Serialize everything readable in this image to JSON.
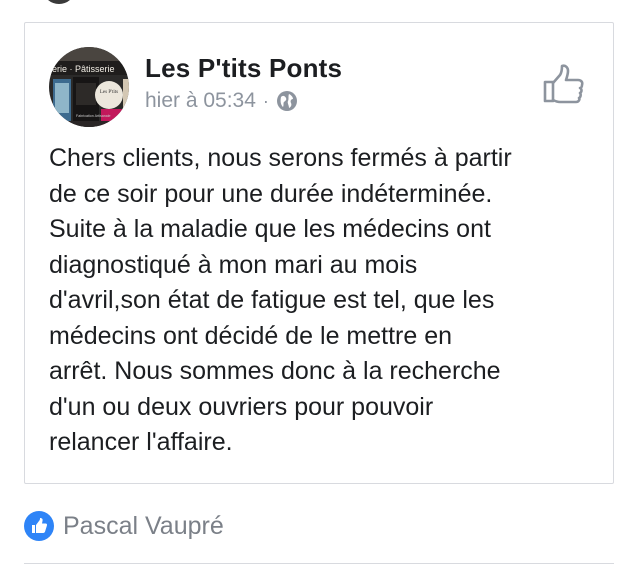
{
  "post": {
    "author": "Les P'tits Ponts",
    "timestamp": "hier à 05:34",
    "separator": "·",
    "audience_icon": "globe-icon",
    "like_icon": "thumbs-up-outline-icon",
    "avatar": {
      "sign_text": "gerie · Pâtisserie",
      "badge_text": "Les P'tits",
      "caption": "Fabrication Artisanale"
    },
    "text": "Chers clients, nous serons fermés à partir\nde ce soir pour une durée indéterminée.\nSuite à la maladie que les médecins ont\ndiagnostiqué à mon mari au mois\nd'avril,son état de fatigue est tel, que les\nmédecins ont décidé de le mettre en\narrêt. Nous sommes donc à la recherche\nd'un ou deux ouvriers pour pouvoir\nrelancer l'affaire."
  },
  "reactions": {
    "icon": "like-reaction-icon",
    "name": "Pascal Vaupré",
    "accent_color": "#2e84f7"
  }
}
